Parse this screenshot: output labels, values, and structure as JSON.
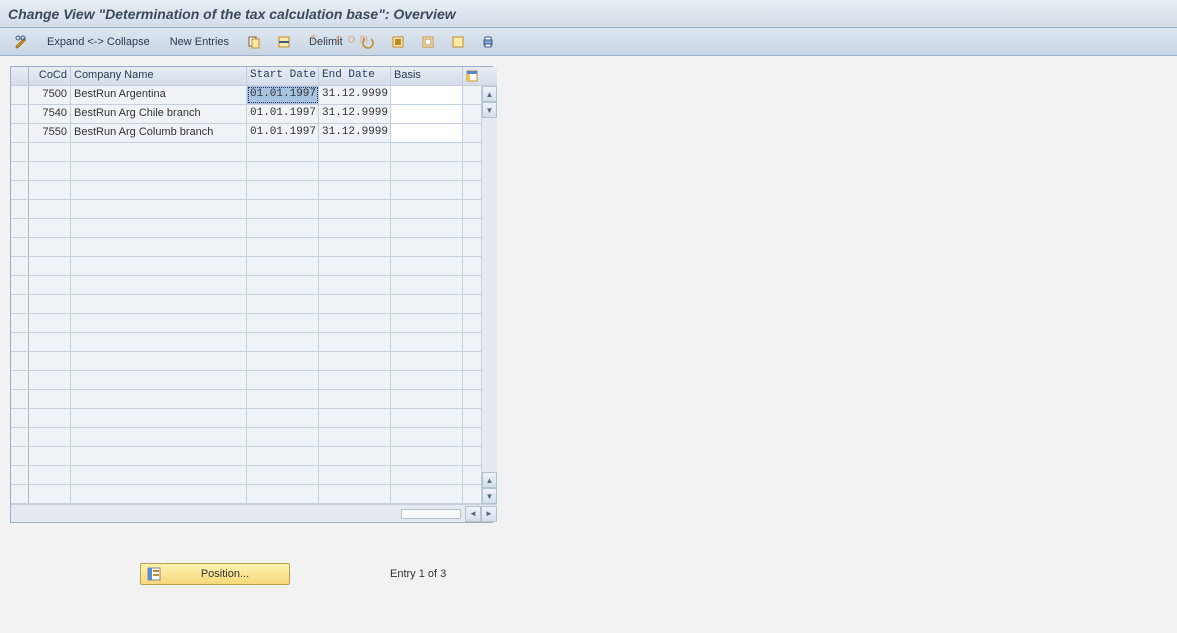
{
  "title": "Change View \"Determination of the tax calculation base\": Overview",
  "toolbar": {
    "expand_collapse": "Expand <-> Collapse",
    "new_entries": "New Entries",
    "delimit": "Delimit"
  },
  "watermark": "t.com",
  "table": {
    "columns": {
      "cocd": "CoCd",
      "name": "Company Name",
      "start": "Start Date",
      "end": "End Date",
      "basis": "Basis"
    },
    "rows": [
      {
        "cocd": "7500",
        "name": "BestRun Argentina",
        "start": "01.01.1997",
        "end": "31.12.9999",
        "basis": ""
      },
      {
        "cocd": "7540",
        "name": "BestRun Arg Chile branch",
        "start": "01.01.1997",
        "end": "31.12.9999",
        "basis": ""
      },
      {
        "cocd": "7550",
        "name": "BestRun Arg Columb branch",
        "start": "01.01.1997",
        "end": "31.12.9999",
        "basis": ""
      }
    ],
    "selected_cell": {
      "row": 0,
      "col": "start"
    },
    "empty_row_count": 19
  },
  "footer": {
    "position_label": "Position...",
    "entry_text": "Entry 1 of 3"
  }
}
